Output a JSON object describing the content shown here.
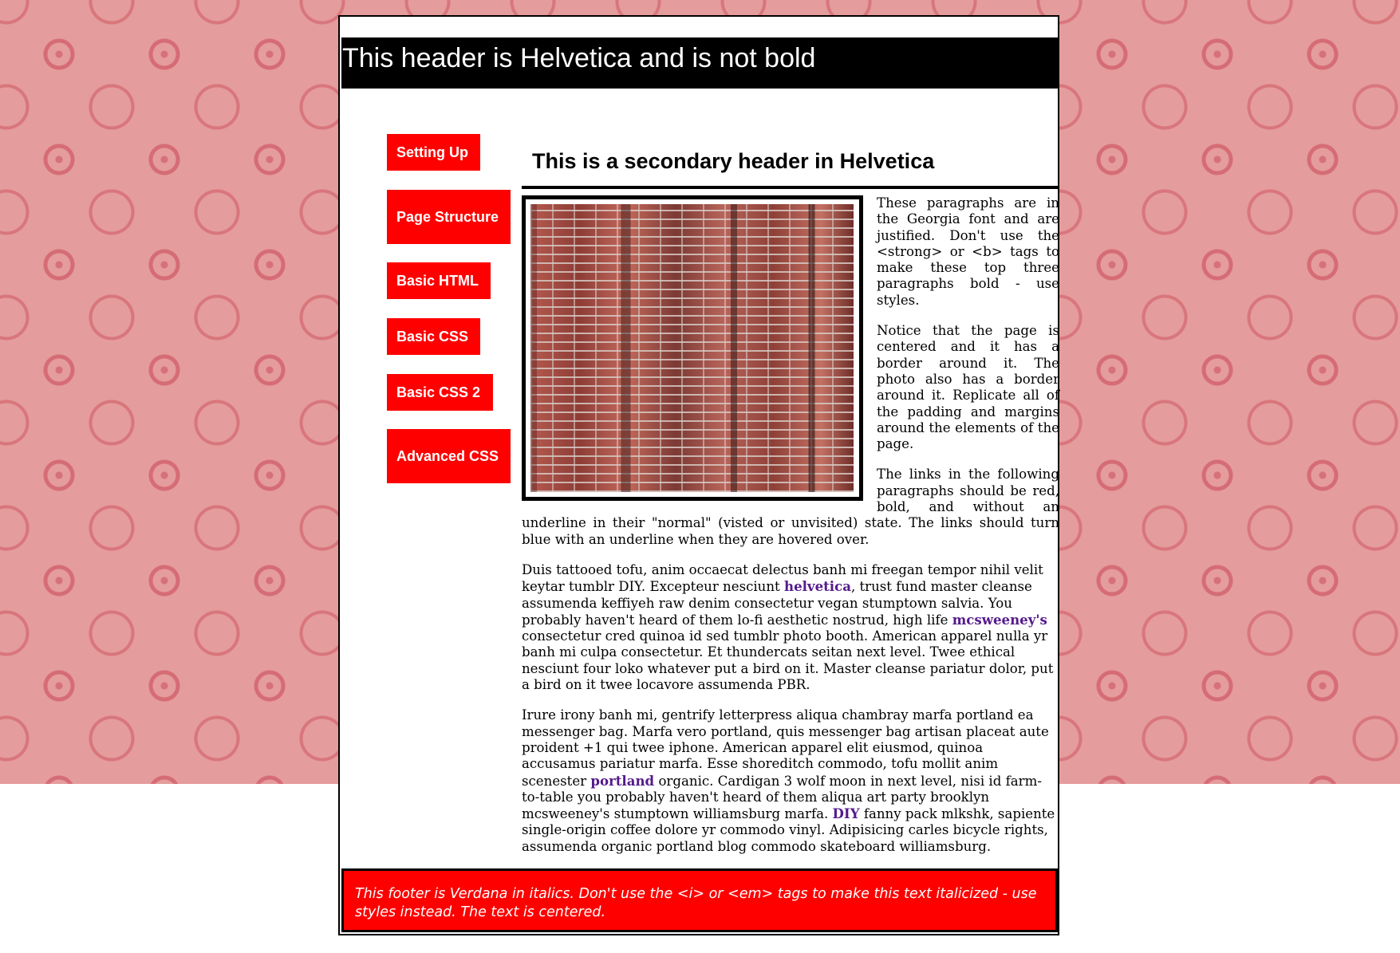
{
  "header": {
    "title": "This header is Helvetica and is not bold"
  },
  "nav": {
    "items": [
      {
        "label": "Setting Up"
      },
      {
        "label": "Page Structure"
      },
      {
        "label": "Basic HTML"
      },
      {
        "label": "Basic CSS"
      },
      {
        "label": "Basic CSS 2"
      },
      {
        "label": "Advanced CSS"
      }
    ]
  },
  "main": {
    "secondary_header": "This is a secondary header in Helvetica",
    "para1": "These paragraphs are in the Georgia font and are justified. Don't use the <strong> or <b> tags to make these top three paragraphs bold - use styles.",
    "para2": "Notice that the page is centered and it has a border around it. The photo also has a border around it. Replicate all of the padding and margins around the elements of the page.",
    "para3": "The links in the following paragraphs should be red, bold, and without an underline in their \"normal\" (visted or unvisited) state. The links should turn blue with an underline when they are hovered over.",
    "para4": {
      "t1": "Duis tattooed tofu, anim occaecat delectus banh mi freegan tempor nihil velit keytar tumblr DIY. Excepteur nesciunt ",
      "link1": "helvetica",
      "t2": ", trust fund master cleanse assumenda keffiyeh raw denim consectetur vegan stumptown salvia. You probably haven't heard of them lo-fi aesthetic nostrud, high life ",
      "link2": "mcsweeney's",
      "t3": " consectetur cred quinoa id sed tumblr photo booth. American apparel nulla yr banh mi culpa consectetur. Et thundercats seitan next level. Twee ethical nesciunt four loko whatever put a bird on it. Master cleanse pariatur dolor, put a bird on it twee locavore assumenda PBR."
    },
    "para5": {
      "t1": "Irure irony banh mi, gentrify letterpress aliqua chambray marfa portland ea messenger bag. Marfa vero portland, quis messenger bag artisan placeat aute proident +1 qui twee iphone. American apparel elit eiusmod, quinoa accusamus pariatur marfa. Esse shoreditch commodo, tofu mollit anim scenester ",
      "link1": "portland",
      "t2": " organic. Cardigan 3 wolf moon in next level, nisi id farm-to-table you probably haven't heard of them aliqua art party brooklyn mcsweeney's stumptown williamsburg marfa. ",
      "link2": "DIY",
      "t3": " fanny pack mlkshk, sapiente single-origin coffee dolore yr commodo vinyl. Adipisicing carles bicycle rights, assumenda organic portland blog commodo skateboard williamsburg."
    }
  },
  "footer": {
    "text": "This footer is Verdana in italics. Don't use the <i> or <em> tags to make this text italicized - use styles instead. The text is centered."
  },
  "colors": {
    "accent": "#ff0000",
    "header_bg": "#000000",
    "link": "#551a8b",
    "link_hover": "#0000ff",
    "background_pattern": "#e59c9c"
  }
}
